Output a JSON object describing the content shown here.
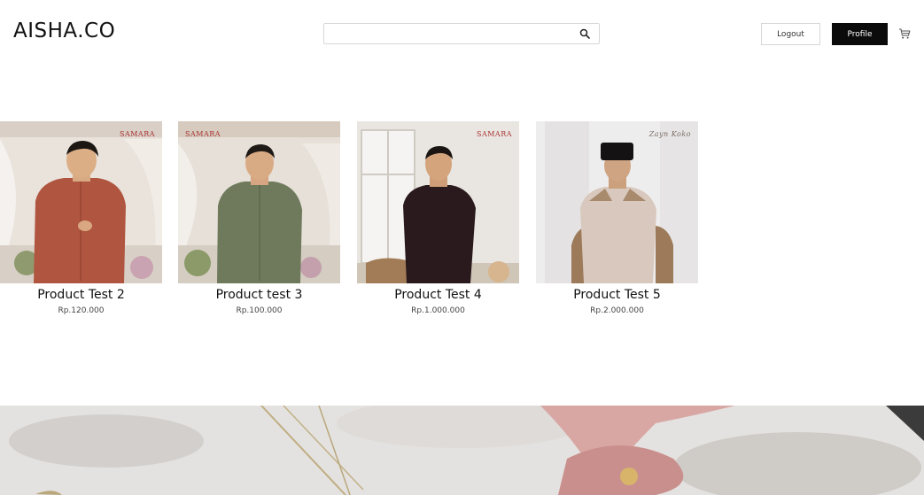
{
  "header": {
    "logo": "AISHA.CO",
    "search": {
      "placeholder": "",
      "value": ""
    },
    "logout_label": "Logout",
    "profile_label": "Profile",
    "icons": {
      "search": "search-icon",
      "cart": "cart-icon"
    }
  },
  "products": [
    {
      "name": "Product Test 2",
      "price": "Rp.120.000",
      "image_brand": "SAMARA",
      "shirt_color": "#b0553f"
    },
    {
      "name": "Product test 3",
      "price": "Rp.100.000",
      "image_brand": "SAMARA",
      "shirt_color": "#6e7a5b"
    },
    {
      "name": "Product Test 4",
      "price": "Rp.1.000.000",
      "image_brand": "SAMARA",
      "shirt_color": "#2b1a1d"
    },
    {
      "name": "Product Test 5",
      "price": "Rp.2.000.000",
      "image_brand": "Zayn Koko",
      "shirt_color": "#d8c8bd"
    }
  ],
  "colors": {
    "accent": "#0b0b0b",
    "border": "#d7d7d7"
  }
}
